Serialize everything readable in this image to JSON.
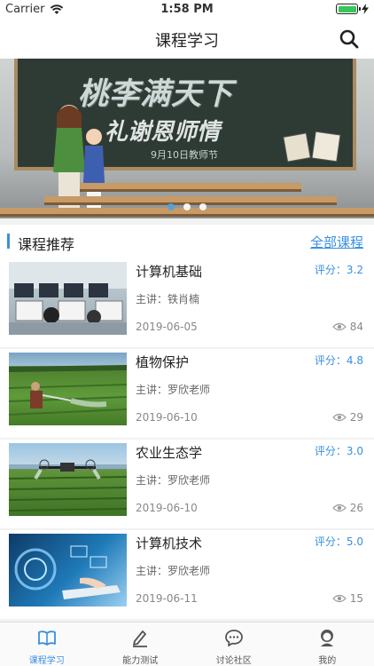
{
  "status_bar": {
    "carrier": "Carrier",
    "time": "1:58 PM",
    "battery_color": "#35c759"
  },
  "nav": {
    "title": "课程学习",
    "search_icon": "search-icon"
  },
  "banner": {
    "line1": "桃李满天下",
    "line2": "礼谢恩师情",
    "line3": "9月10日教师节",
    "page_count": 3,
    "active_page": 1
  },
  "section": {
    "title": "课程推荐",
    "more_label": "全部课程",
    "accent": "#3a8fe0"
  },
  "courses": [
    {
      "title": "计算机基础",
      "score": "评分：3.2",
      "teacher": "主讲：铁肖楠",
      "date": "2019-06-05",
      "views": "84"
    },
    {
      "title": "植物保护",
      "score": "评分：4.8",
      "teacher": "主讲：罗欣老师",
      "date": "2019-06-10",
      "views": "29"
    },
    {
      "title": "农业生态学",
      "score": "评分：3.0",
      "teacher": "主讲：罗欣老师",
      "date": "2019-06-10",
      "views": "26"
    },
    {
      "title": "计算机技术",
      "score": "评分：5.0",
      "teacher": "主讲：罗欣老师",
      "date": "2019-06-11",
      "views": "15"
    }
  ],
  "tabs": [
    {
      "label": "课程学习",
      "icon": "book-icon",
      "active": true
    },
    {
      "label": "能力测试",
      "icon": "pen-icon",
      "active": false
    },
    {
      "label": "讨论社区",
      "icon": "chat-icon",
      "active": false
    },
    {
      "label": "我的",
      "icon": "user-icon",
      "active": false
    }
  ]
}
